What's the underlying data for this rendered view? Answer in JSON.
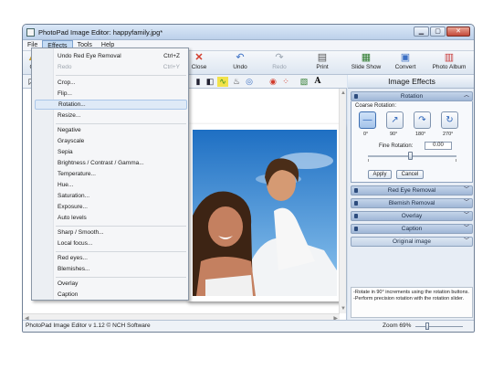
{
  "window": {
    "title": "PhotoPad Image Editor: happyfamily.jpg*"
  },
  "menubar": {
    "items": [
      "File",
      "Effects",
      "Tools",
      "Help"
    ]
  },
  "toolbar": {
    "buttons": [
      {
        "label": "Close",
        "icon": "x-icon",
        "color": "#d23b2b"
      },
      {
        "label": "Undo",
        "icon": "undo-icon",
        "color": "#3a6fc4"
      },
      {
        "label": "Redo",
        "icon": "redo-icon",
        "color": "#9aa4b0",
        "disabled": true
      },
      {
        "label": "Print",
        "icon": "print-icon",
        "color": "#555"
      },
      {
        "label": "Slide Show",
        "icon": "slideshow-icon",
        "color": "#2d7a2d"
      },
      {
        "label": "Convert",
        "icon": "convert-icon",
        "color": "#3a6fc4"
      },
      {
        "label": "Photo Album",
        "icon": "album-icon",
        "color": "#c73a3a"
      }
    ],
    "partial_first_label": "O"
  },
  "effects_menu": {
    "items": [
      {
        "label": "Undo Red Eye Removal",
        "shortcut": "Ctrl+Z"
      },
      {
        "label": "Redo",
        "shortcut": "Ctrl+Y",
        "disabled": true
      },
      {
        "label": "Crop..."
      },
      {
        "label": "Flip..."
      },
      {
        "label": "Rotation...",
        "highlighted": true
      },
      {
        "label": "Resize..."
      },
      {
        "label": "Negative"
      },
      {
        "label": "Grayscale"
      },
      {
        "label": "Sepia"
      },
      {
        "label": "Brightness / Contrast / Gamma..."
      },
      {
        "label": "Temperature..."
      },
      {
        "label": "Hue..."
      },
      {
        "label": "Saturation..."
      },
      {
        "label": "Exposure..."
      },
      {
        "label": "Auto levels"
      },
      {
        "label": "Sharp / Smooth..."
      },
      {
        "label": "Local focus..."
      },
      {
        "label": "Red eyes..."
      },
      {
        "label": "Blemishes..."
      },
      {
        "label": "Overlay"
      },
      {
        "label": "Caption"
      }
    ]
  },
  "panel": {
    "title": "Image Effects",
    "rotation": {
      "header": "Rotation",
      "coarse_label": "Coarse Rotation:",
      "angles": [
        "0°",
        "90°",
        "180°",
        "270°"
      ],
      "fine_label": "Fine Rotation:",
      "fine_value": "0.00",
      "apply": "Apply",
      "cancel": "Cancel"
    },
    "sections": [
      "Red Eye Removal",
      "Blemish Removal",
      "Overlay",
      "Caption"
    ],
    "original": "Original image",
    "description": "-Rotate in 90° increments using the rotation buttons. -Perform precision rotation with the rotation slider."
  },
  "status": {
    "left": "PhotoPad Image Editor v 1.12 © NCH Software",
    "zoom": "Zoom 69%"
  }
}
